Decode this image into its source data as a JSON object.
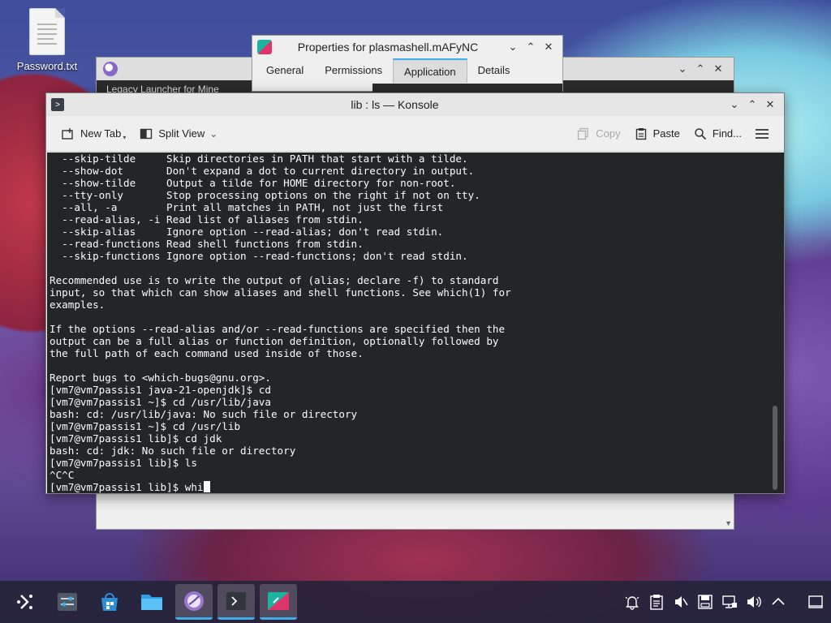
{
  "desktop": {
    "icons": [
      {
        "label": "Password.txt",
        "icon": "text-file-icon"
      }
    ]
  },
  "background_window": {
    "app_icon": "app-launcher-icon",
    "row_text": "Legacy Launcher for Mine",
    "controls": [
      "minimize",
      "maximize",
      "close"
    ]
  },
  "properties_dialog": {
    "title": "Properties for plasmashell.mAFyNC",
    "tabs": [
      {
        "label": "General",
        "active": false
      },
      {
        "label": "Permissions",
        "active": false
      },
      {
        "label": "Application",
        "active": true
      },
      {
        "label": "Details",
        "active": false
      }
    ]
  },
  "konsole": {
    "title": "lib : ls — Konsole",
    "toolbar": {
      "new_tab": "New Tab",
      "split_view": "Split View",
      "copy": "Copy",
      "paste": "Paste",
      "find": "Find..."
    },
    "terminal_lines": [
      "  --skip-tilde     Skip directories in PATH that start with a tilde.",
      "  --show-dot       Don't expand a dot to current directory in output.",
      "  --show-tilde     Output a tilde for HOME directory for non-root.",
      "  --tty-only       Stop processing options on the right if not on tty.",
      "  --all, -a        Print all matches in PATH, not just the first",
      "  --read-alias, -i Read list of aliases from stdin.",
      "  --skip-alias     Ignore option --read-alias; don't read stdin.",
      "  --read-functions Read shell functions from stdin.",
      "  --skip-functions Ignore option --read-functions; don't read stdin.",
      "",
      "Recommended use is to write the output of (alias; declare -f) to standard",
      "input, so that which can show aliases and shell functions. See which(1) for",
      "examples.",
      "",
      "If the options --read-alias and/or --read-functions are specified then the",
      "output can be a full alias or function definition, optionally followed by",
      "the full path of each command used inside of those.",
      "",
      "Report bugs to <which-bugs@gnu.org>.",
      "[vm7@vm7passis1 java-21-openjdk]$ cd",
      "[vm7@vm7passis1 ~]$ cd /usr/lib/java",
      "bash: cd: /usr/lib/java: No such file or directory",
      "[vm7@vm7passis1 ~]$ cd /usr/lib",
      "[vm7@vm7passis1 lib]$ cd jdk",
      "bash: cd: jdk: No such file or directory",
      "[vm7@vm7passis1 lib]$ ls",
      "^C^C",
      "[vm7@vm7passis1 lib]$ whi"
    ]
  },
  "taskbar": {
    "items": [
      {
        "icon": "application-launcher-icon",
        "active": false
      },
      {
        "icon": "system-settings-icon",
        "active": false
      },
      {
        "icon": "discover-store-icon",
        "active": false
      },
      {
        "icon": "file-manager-icon",
        "active": false
      },
      {
        "icon": "app-launcher-icon",
        "active": true
      },
      {
        "icon": "konsole-icon",
        "active": true
      },
      {
        "icon": "kate-icon",
        "active": true
      }
    ],
    "tray": [
      "notifications-icon",
      "clipboard-icon",
      "audio-muted-icon",
      "storage-icon",
      "network-icon",
      "volume-icon",
      "show-hidden-icon",
      "show-desktop-icon"
    ]
  }
}
